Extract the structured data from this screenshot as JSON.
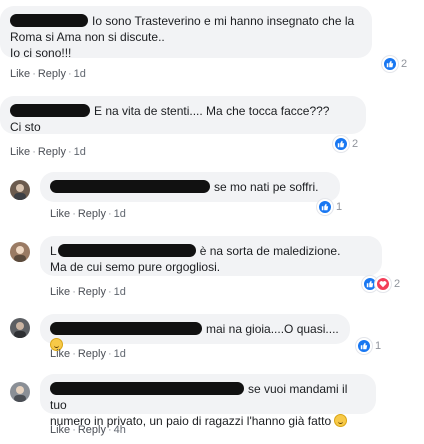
{
  "comments": [
    {
      "text_line1": "Io sono Trasteverino e mi hanno insegnato che la",
      "text_line2": "Roma si Ama non si discute..",
      "text_line3": "Io ci sono!!!",
      "like": "Like",
      "reply": "Reply",
      "time": "1d",
      "reactions": "2"
    },
    {
      "text_line1": "E na vita de stenti.... Ma che tocca facce???",
      "text_line2": "Ci sto",
      "like": "Like",
      "reply": "Reply",
      "time": "1d",
      "reactions": "2"
    }
  ],
  "replies": [
    {
      "text_line1": "se mo nati pe soffri.",
      "like": "Like",
      "reply": "Reply",
      "time": "1d",
      "reactions": "1"
    },
    {
      "text_prefix": "L",
      "text_line1": "è na sorta de maledizione.",
      "text_line2": "Ma de cui semo pure orgogliosi.",
      "like": "Like",
      "reply": "Reply",
      "time": "1d",
      "reactions": "2"
    },
    {
      "text_line1": "mai na gioia....O quasi....",
      "like": "Like",
      "reply": "Reply",
      "time": "1d",
      "reactions": "1"
    },
    {
      "text_line1": "se vuoi mandami il tuo",
      "text_line2": "numero in privato, un paio di ragazzi l'hanno già fatto",
      "like": "Like",
      "reply": "Reply",
      "time": "4h"
    }
  ],
  "colors": {
    "bubble": "#f2f3f5",
    "like_blue": "#1877f2",
    "love_red": "#f33e58",
    "meta_gray": "#616770"
  },
  "icons": {
    "like": "thumbs-up-icon",
    "love": "heart-icon",
    "emoji": "smiley-icon"
  }
}
